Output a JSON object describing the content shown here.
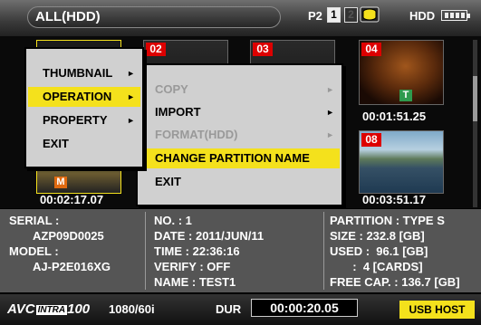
{
  "header": {
    "title": "ALL(HDD)",
    "p2_label": "P2",
    "slot1": "1",
    "slot2": "2",
    "hdd_label": "HDD",
    "hdd_icon": "hdd-cylinder-icon",
    "battery_icon": "battery-icon"
  },
  "thumbnails": [
    {
      "num": "02"
    },
    {
      "num": "03"
    },
    {
      "num": "04",
      "badge": "T",
      "timecode": "00:01:51.25"
    },
    {
      "num": "08",
      "timecode": "00:03:51.17"
    },
    {
      "badge": "M",
      "timecode": "00:02:17.07"
    }
  ],
  "menu": {
    "items": [
      {
        "label": "THUMBNAIL",
        "arrow": "►"
      },
      {
        "label": "OPERATION",
        "arrow": "►",
        "selected": true
      },
      {
        "label": "PROPERTY",
        "arrow": "►"
      },
      {
        "label": "EXIT"
      }
    ]
  },
  "submenu": {
    "items": [
      {
        "label": "COPY",
        "arrow": "►",
        "disabled": true
      },
      {
        "label": "IMPORT",
        "arrow": "►"
      },
      {
        "label": "FORMAT(HDD)",
        "arrow": "►",
        "disabled": true
      },
      {
        "label": "CHANGE PARTITION NAME",
        "selected": true
      },
      {
        "label": "EXIT"
      }
    ]
  },
  "info": {
    "serial_label": "SERIAL :",
    "serial_value": "AZP09D0025",
    "model_label": "MODEL :",
    "model_value": "AJ-P2E016XG",
    "no": "NO. : 1",
    "date": "DATE : 2011/JUN/11",
    "time": "TIME : 22:36:16",
    "verify": "VERIFY : OFF",
    "name": "NAME : TEST1",
    "partition": "PARTITION : TYPE S",
    "size": "SIZE : 232.8 [GB]",
    "used": "USED :  96.1 [GB]",
    "cards": "       :  4 [CARDS]",
    "free": "FREE CAP. : 136.7 [GB]"
  },
  "footer": {
    "avc": "AVC",
    "intra": "INTRA",
    "avc_num": "100",
    "format": "1080/60i",
    "dur_label": "DUR",
    "duration": "00:00:20.05",
    "usb": "USB HOST"
  },
  "colors": {
    "highlight": "#f4e11c",
    "number_badge": "#dd0000",
    "t_badge": "#2e9a4e",
    "m_badge": "#e06a10"
  }
}
